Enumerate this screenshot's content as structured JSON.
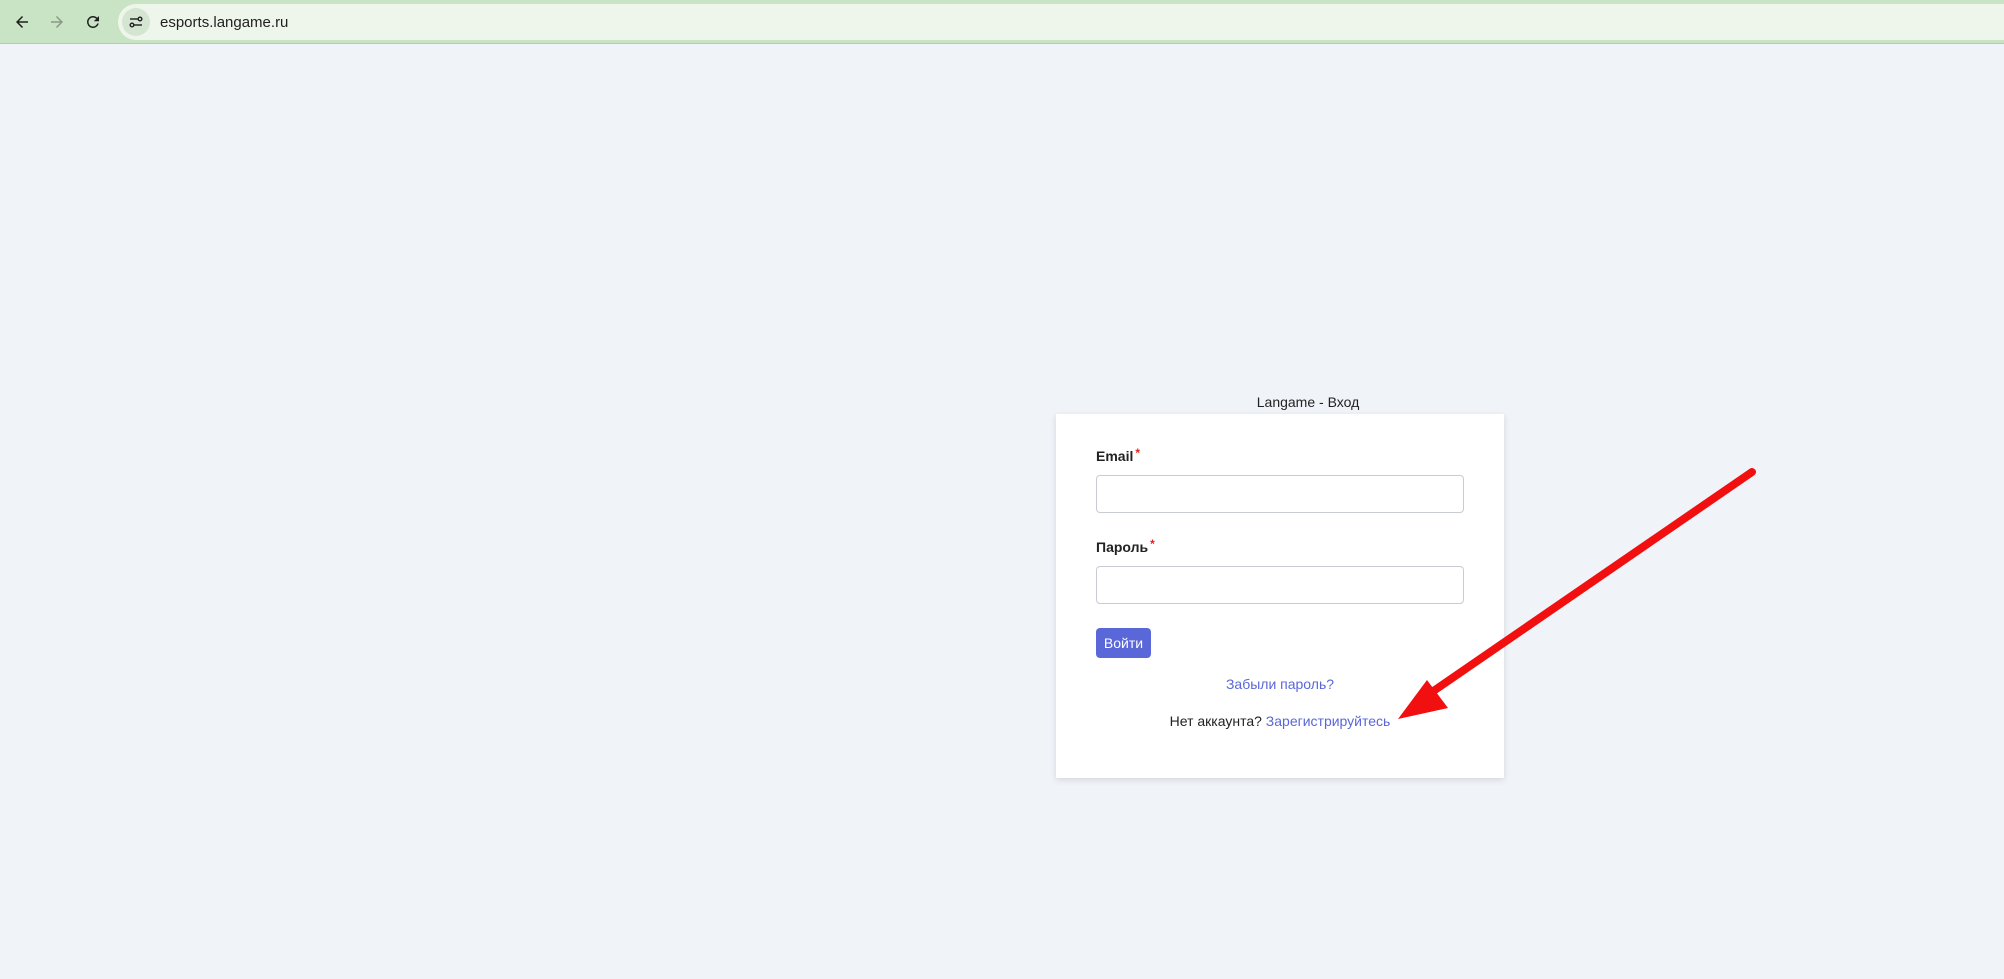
{
  "browser": {
    "url": "esports.langame.ru",
    "icons": [
      "back-arrow-icon",
      "forward-arrow-icon",
      "reload-icon",
      "site-settings-icon"
    ]
  },
  "page": {
    "heading": "Langame - Вход"
  },
  "form": {
    "email_label": "Email",
    "email_value": "",
    "password_label": "Пароль",
    "password_value": "",
    "required_mark": "*",
    "submit_label": "Войти",
    "forgot_link": "Забыли пароль?",
    "no_account_text": "Нет аккаунта?",
    "register_link": "Зарегистрируйтесь"
  },
  "colors": {
    "browser_bar": "#c9e4c4",
    "page_background": "#f0f4f9",
    "accent": "#5a67d8",
    "required": "#e02424",
    "annotation_arrow": "#f20f0f"
  }
}
